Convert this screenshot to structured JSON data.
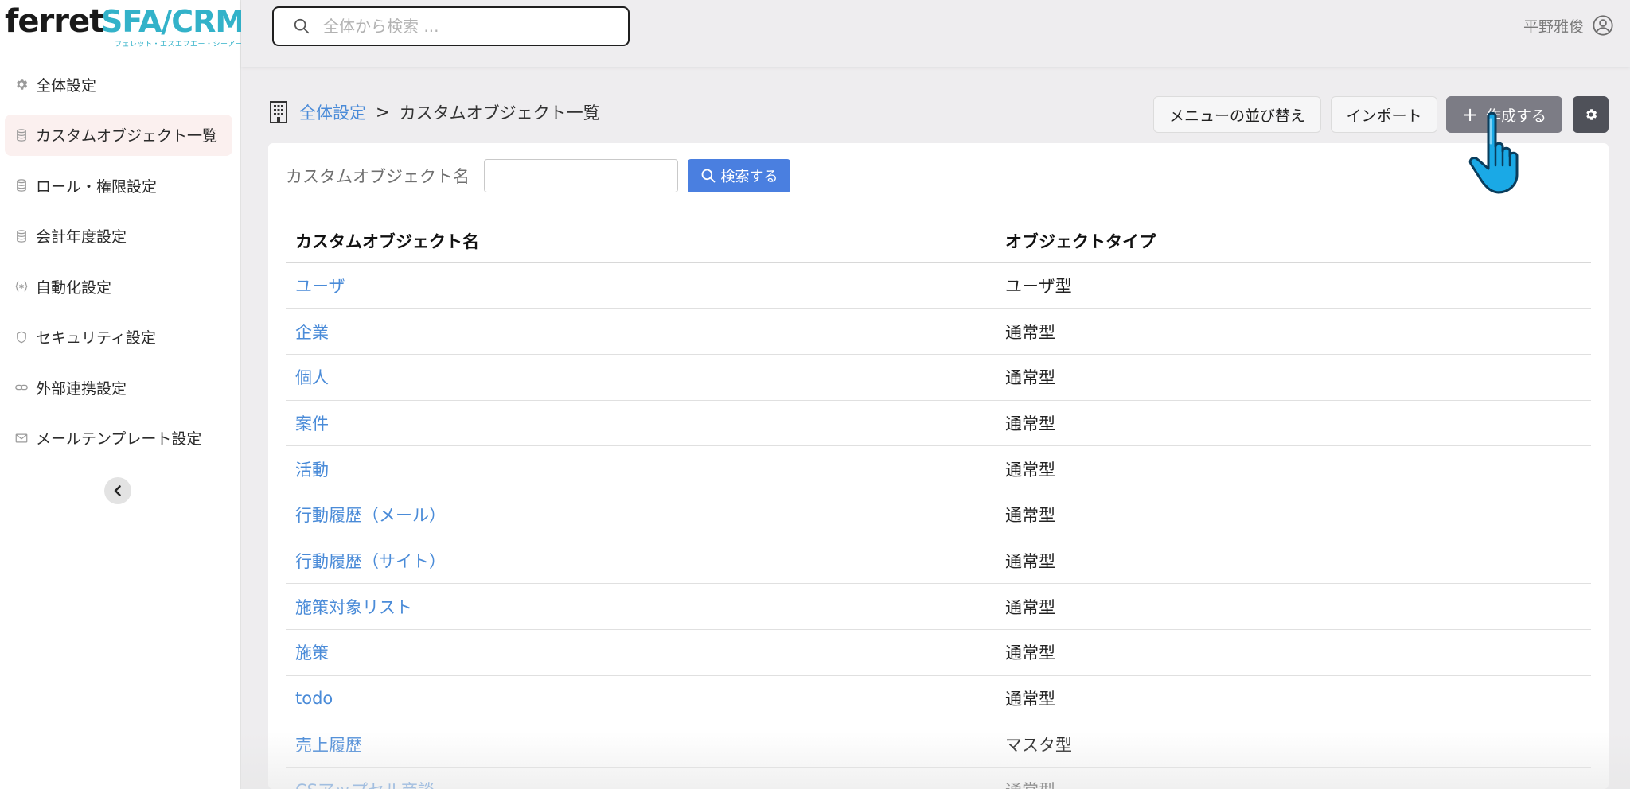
{
  "logo": {
    "brand": "ferret",
    "product": "SFA/CRM",
    "kana": "フェレット・エスエフエー・シーアールエム"
  },
  "sidebar": {
    "items": [
      {
        "label": "全体設定",
        "icon": "gear-icon",
        "active": false
      },
      {
        "label": "カスタムオブジェクト一覧",
        "icon": "database-icon",
        "active": true
      },
      {
        "label": "ロール・権限設定",
        "icon": "database-icon",
        "active": false
      },
      {
        "label": "会計年度設定",
        "icon": "database-icon",
        "active": false
      },
      {
        "label": "自動化設定",
        "icon": "automation-icon",
        "active": false
      },
      {
        "label": "セキュリティ設定",
        "icon": "shield-icon",
        "active": false
      },
      {
        "label": "外部連携設定",
        "icon": "link-icon",
        "active": false
      },
      {
        "label": "メールテンプレート設定",
        "icon": "mail-icon",
        "active": false
      }
    ],
    "collapse_icon": "chevron-left-icon"
  },
  "topbar": {
    "search_placeholder": "全体から検索 ...",
    "user_name": "平野雅俊",
    "user_icon": "user-circle-icon"
  },
  "breadcrumb": {
    "icon": "building-icon",
    "parent": "全体設定",
    "separator": ">",
    "current": "カスタムオブジェクト一覧"
  },
  "actions": {
    "reorder_menu": "メニューの並び替え",
    "import": "インポート",
    "create": "作成する",
    "settings_icon": "gear-icon"
  },
  "filter": {
    "label": "カスタムオブジェクト名",
    "input_value": "",
    "search_button": "検索する"
  },
  "table": {
    "headers": [
      "カスタムオブジェクト名",
      "オブジェクトタイプ"
    ],
    "rows": [
      {
        "name": "ユーザ",
        "type": "ユーザ型"
      },
      {
        "name": "企業",
        "type": "通常型"
      },
      {
        "name": "個人",
        "type": "通常型"
      },
      {
        "name": "案件",
        "type": "通常型"
      },
      {
        "name": "活動",
        "type": "通常型"
      },
      {
        "name": "行動履歴（メール）",
        "type": "通常型"
      },
      {
        "name": "行動履歴（サイト）",
        "type": "通常型"
      },
      {
        "name": "施策対象リスト",
        "type": "通常型"
      },
      {
        "name": "施策",
        "type": "通常型"
      },
      {
        "name": "todo",
        "type": "通常型"
      },
      {
        "name": "売上履歴",
        "type": "マスタ型"
      },
      {
        "name": "CSアップセル商談",
        "type": "通常型"
      }
    ]
  },
  "colors": {
    "link": "#4a8bd8",
    "brand": "#33b2c9",
    "primary_button": "#4a7fe0"
  }
}
